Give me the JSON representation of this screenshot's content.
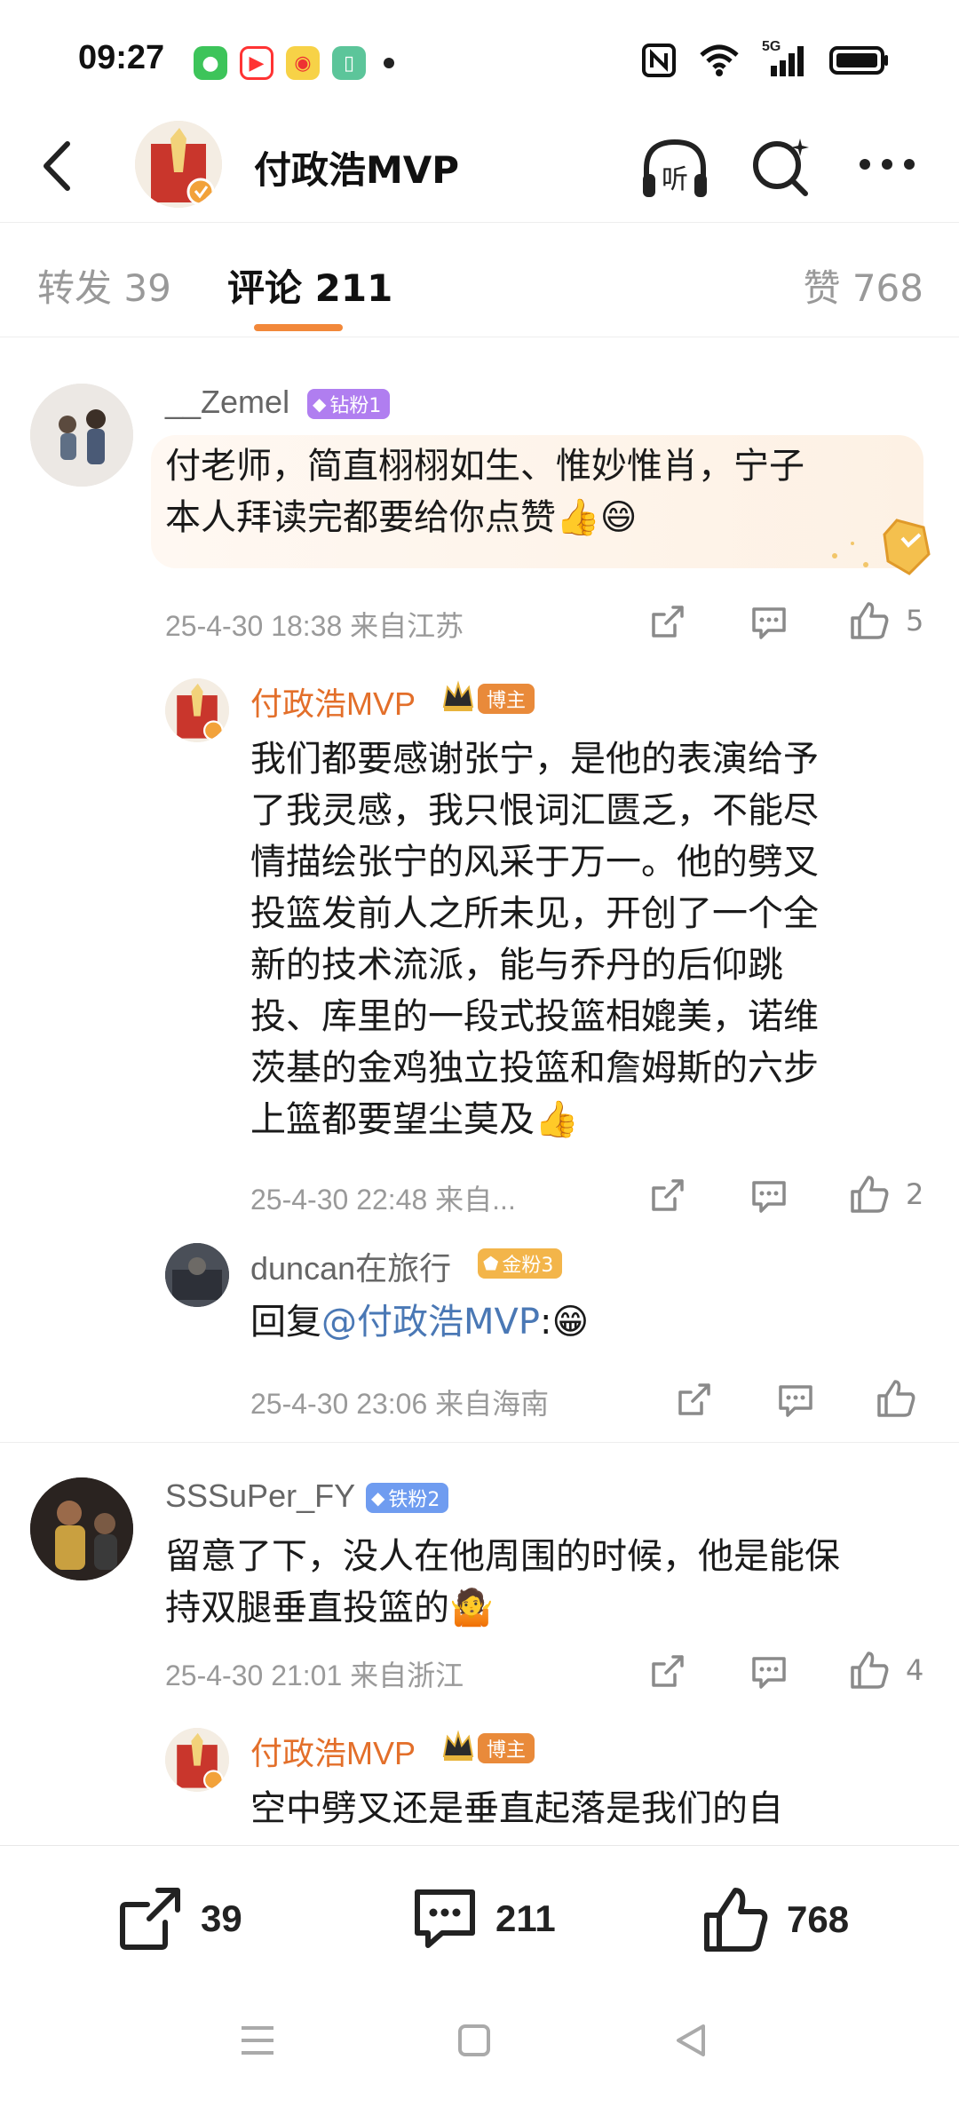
{
  "status": {
    "time": "09:27",
    "network": "5G"
  },
  "header": {
    "title": "付政浩MVP",
    "listen_label": "听"
  },
  "tabs": [
    {
      "label": "转发 39"
    },
    {
      "label": "评论 211"
    },
    {
      "label": "赞 768"
    }
  ],
  "comments": [
    {
      "user": "__Zemel",
      "badge": "钻粉1",
      "text_line1": "付老师，简直栩栩如生、惟妙惟肖，宁子",
      "text_line2": "本人拜读完都要给你点赞👍😄",
      "meta": "25-4-30 18:38 来自江苏",
      "likes": "5"
    },
    {
      "user": "付政浩MVP",
      "badge": "博主",
      "lines": [
        "我们都要感谢张宁，是他的表演给予",
        "了我灵感，我只恨词汇匮乏，不能尽",
        "情描绘张宁的风采于万一。他的劈叉",
        "投篮发前人之所未见，开创了一个全",
        "新的技术流派，能与乔丹的后仰跳",
        "投、库里的一段式投篮相媲美，诺维",
        "茨基的金鸡独立投篮和詹姆斯的六步",
        "上篮都要望尘莫及👍"
      ],
      "meta": "25-4-30 22:48 来自...",
      "likes": "2"
    },
    {
      "user": "duncan在旅行",
      "badge": "金粉3",
      "text_prefix": "回复",
      "mention": "@付政浩MVP",
      "text_suffix": ":😁",
      "meta": "25-4-30 23:06 来自海南"
    },
    {
      "user": "SSSuPer_FY",
      "badge": "铁粉2",
      "text_line1": "留意了下，没人在他周围的时候，他是能保",
      "text_line2": "持双腿垂直投篮的🤷",
      "meta": "25-4-30 21:01 来自浙江",
      "likes": "4"
    },
    {
      "user": "付政浩MVP",
      "badge": "博主",
      "text_line1": "空中劈叉还是垂直起落是我们的自"
    }
  ],
  "bottom_bar": {
    "repost_count": "39",
    "comment_count": "211",
    "like_count": "768"
  },
  "colors": {
    "accent": "#f2883a",
    "blogger_name": "#e36f2a",
    "mention": "#4a78b5",
    "badge_diamond": "#b07ef0",
    "badge_gold": "#f3b54a",
    "badge_iron": "#6f9cf0",
    "badge_blogger": "#e98a3a"
  }
}
